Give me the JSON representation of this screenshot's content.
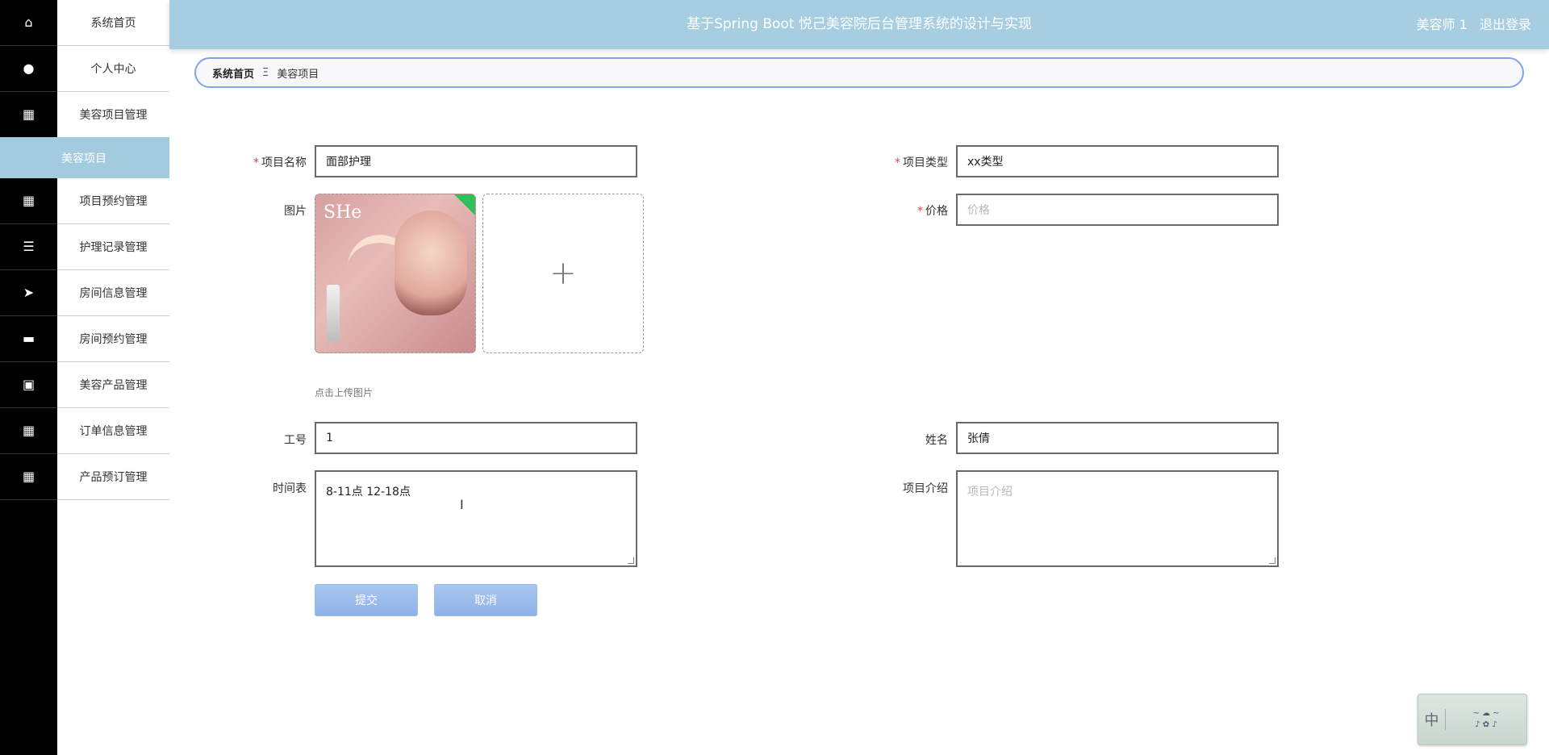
{
  "header": {
    "title": "基于Spring Boot 悦己美容院后台管理系统的设计与实现",
    "user_name": "美容师 1",
    "logout": "退出登录"
  },
  "sidebar": {
    "items": [
      {
        "label": "系统首页",
        "icon": "home-icon"
      },
      {
        "label": "个人中心",
        "icon": "user-icon"
      },
      {
        "label": "美容项目管理",
        "icon": "grid-icon"
      },
      {
        "label": "项目预约管理",
        "icon": "grid-icon"
      },
      {
        "label": "护理记录管理",
        "icon": "list-icon"
      },
      {
        "label": "房间信息管理",
        "icon": "send-icon"
      },
      {
        "label": "房间预约管理",
        "icon": "box-icon"
      },
      {
        "label": "美容产品管理",
        "icon": "chat-icon"
      },
      {
        "label": "订单信息管理",
        "icon": "grid-icon"
      },
      {
        "label": "产品预订管理",
        "icon": "grid-icon"
      }
    ],
    "active_sub": "美容项目"
  },
  "breadcrumb": {
    "home": "系统首页",
    "separator": "Ξ",
    "current": "美容项目"
  },
  "form": {
    "name_label": "项目名称",
    "name_value": "面部护理",
    "type_label": "项目类型",
    "type_value": "xx类型",
    "image_label": "图片",
    "image_brand": "SHe",
    "upload_tip": "点击上传图片",
    "upload_plus": "+",
    "price_label": "价格",
    "price_placeholder": "价格",
    "job_no_label": "工号",
    "job_no_value": "1",
    "staff_name_label": "姓名",
    "staff_name_value": "张倩",
    "schedule_label": "时间表",
    "schedule_value": "8-11点 12-18点",
    "intro_label": "项目介绍",
    "intro_placeholder": "项目介绍",
    "required_mark": "*",
    "submit": "提交",
    "cancel": "取消"
  },
  "ime": {
    "lang": "中"
  }
}
